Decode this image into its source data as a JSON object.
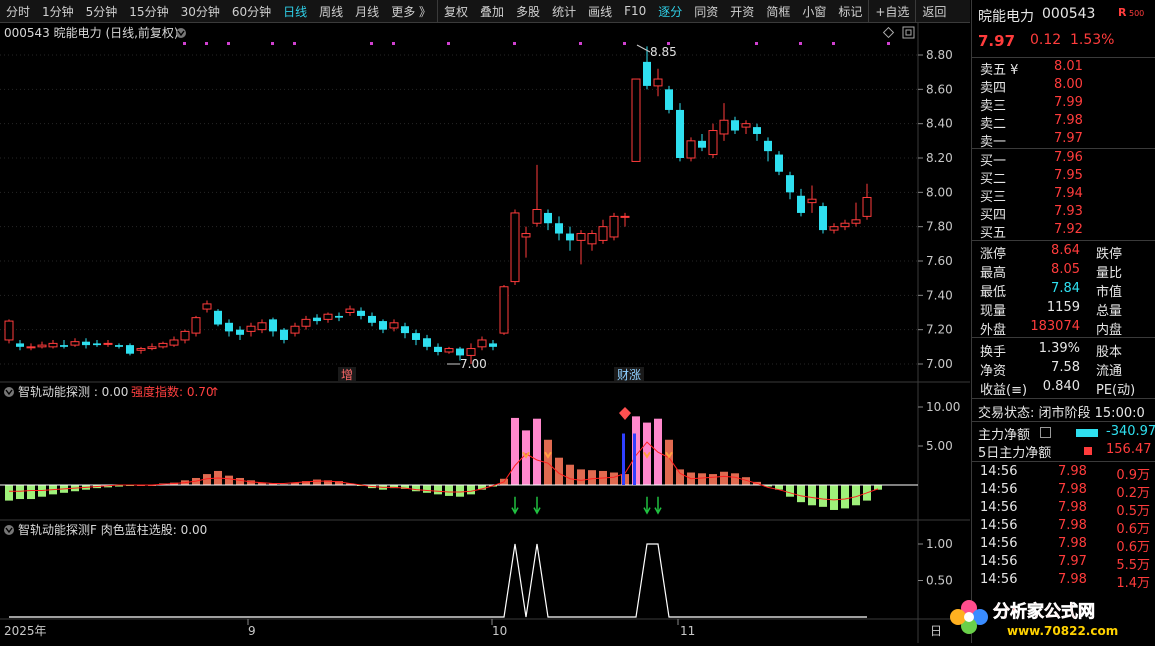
{
  "toolbar": {
    "items": [
      {
        "label": "分时"
      },
      {
        "label": "1分钟"
      },
      {
        "label": "5分钟"
      },
      {
        "label": "15分钟"
      },
      {
        "label": "30分钟"
      },
      {
        "label": "60分钟"
      },
      {
        "label": "日线",
        "active": true
      },
      {
        "label": "周线"
      },
      {
        "label": "月线"
      },
      {
        "label": "更多 》"
      },
      {
        "label": "复权"
      },
      {
        "label": "叠加"
      },
      {
        "label": "多股"
      },
      {
        "label": "统计"
      },
      {
        "label": "画线"
      },
      {
        "label": "F10"
      },
      {
        "label": "逐分",
        "active": true
      },
      {
        "label": "同资"
      },
      {
        "label": "开资"
      },
      {
        "label": "简框"
      },
      {
        "label": "小窗"
      },
      {
        "label": "标记"
      },
      {
        "label": "+自选"
      },
      {
        "label": "返回"
      }
    ]
  },
  "main_chart": {
    "title": "000543 晥能电力 (日线,前复权)",
    "high_marker": "8.85",
    "low_marker": "7.00",
    "tags": [
      "增",
      "财涨"
    ],
    "y_ticks": [
      "8.80",
      "8.60",
      "8.40",
      "8.20",
      "8.00",
      "7.80",
      "7.60",
      "7.40",
      "7.20",
      "7.00"
    ],
    "icons": [
      "collapse-icon",
      "diamond-icon",
      "window-icon"
    ]
  },
  "indicator1": {
    "title": "智轨动能探测 : 0.00",
    "extra": "强度指数: 0.70",
    "y_ticks": [
      "10.00",
      "5.00"
    ]
  },
  "indicator2": {
    "title": "智轨动能探测F  肉色蓝柱选股: 0.00",
    "y_ticks": [
      "1.00",
      "0.50"
    ]
  },
  "x_axis": {
    "labels": [
      "2025年",
      "9",
      "10",
      "11",
      "日"
    ]
  },
  "chart_data": {
    "type": "candlestick",
    "ylim": [
      6.95,
      8.9
    ],
    "candles": [
      [
        7.14,
        7.25,
        7.26,
        7.12
      ],
      [
        7.12,
        7.1,
        7.14,
        7.08
      ],
      [
        7.1,
        7.1,
        7.12,
        7.08
      ],
      [
        7.1,
        7.11,
        7.13,
        7.09
      ],
      [
        7.1,
        7.12,
        7.14,
        7.09
      ],
      [
        7.11,
        7.1,
        7.14,
        7.09
      ],
      [
        7.11,
        7.13,
        7.15,
        7.1
      ],
      [
        7.13,
        7.11,
        7.15,
        7.09
      ],
      [
        7.12,
        7.11,
        7.14,
        7.1
      ],
      [
        7.12,
        7.12,
        7.14,
        7.1
      ],
      [
        7.11,
        7.1,
        7.12,
        7.09
      ],
      [
        7.11,
        7.06,
        7.12,
        7.05
      ],
      [
        7.08,
        7.09,
        7.1,
        7.06
      ],
      [
        7.09,
        7.1,
        7.12,
        7.08
      ],
      [
        7.1,
        7.12,
        7.13,
        7.09
      ],
      [
        7.11,
        7.14,
        7.16,
        7.1
      ],
      [
        7.14,
        7.19,
        7.2,
        7.12
      ],
      [
        7.18,
        7.27,
        7.28,
        7.16
      ],
      [
        7.32,
        7.35,
        7.37,
        7.3
      ],
      [
        7.31,
        7.23,
        7.32,
        7.22
      ],
      [
        7.24,
        7.19,
        7.26,
        7.16
      ],
      [
        7.2,
        7.17,
        7.22,
        7.14
      ],
      [
        7.19,
        7.22,
        7.24,
        7.16
      ],
      [
        7.2,
        7.24,
        7.26,
        7.18
      ],
      [
        7.26,
        7.19,
        7.27,
        7.16
      ],
      [
        7.2,
        7.14,
        7.21,
        7.12
      ],
      [
        7.18,
        7.22,
        7.24,
        7.16
      ],
      [
        7.22,
        7.26,
        7.28,
        7.2
      ],
      [
        7.27,
        7.25,
        7.29,
        7.23
      ],
      [
        7.26,
        7.29,
        7.3,
        7.24
      ],
      [
        7.28,
        7.27,
        7.3,
        7.25
      ],
      [
        7.3,
        7.32,
        7.34,
        7.28
      ],
      [
        7.31,
        7.28,
        7.33,
        7.26
      ],
      [
        7.28,
        7.24,
        7.3,
        7.22
      ],
      [
        7.25,
        7.2,
        7.26,
        7.18
      ],
      [
        7.21,
        7.24,
        7.26,
        7.19
      ],
      [
        7.22,
        7.18,
        7.24,
        7.15
      ],
      [
        7.18,
        7.14,
        7.2,
        7.11
      ],
      [
        7.15,
        7.1,
        7.17,
        7.08
      ],
      [
        7.1,
        7.07,
        7.12,
        7.05
      ],
      [
        7.07,
        7.09,
        7.1,
        7.06
      ],
      [
        7.09,
        7.05,
        7.1,
        7.02
      ],
      [
        7.05,
        7.09,
        7.12,
        7.0
      ],
      [
        7.1,
        7.14,
        7.16,
        7.08
      ],
      [
        7.12,
        7.1,
        7.14,
        7.08
      ],
      [
        7.18,
        7.45,
        7.46,
        7.17
      ],
      [
        7.48,
        7.88,
        7.9,
        7.46
      ],
      [
        7.74,
        7.76,
        7.8,
        7.62
      ],
      [
        7.82,
        7.9,
        8.16,
        7.8
      ],
      [
        7.88,
        7.82,
        7.9,
        7.78
      ],
      [
        7.82,
        7.76,
        7.86,
        7.72
      ],
      [
        7.76,
        7.72,
        7.8,
        7.66
      ],
      [
        7.72,
        7.76,
        7.78,
        7.58
      ],
      [
        7.7,
        7.76,
        7.78,
        7.66
      ],
      [
        7.72,
        7.8,
        7.84,
        7.7
      ],
      [
        7.74,
        7.86,
        7.88,
        7.72
      ],
      [
        7.86,
        7.86,
        7.88,
        7.8
      ],
      [
        8.18,
        8.66,
        8.66,
        8.18
      ],
      [
        8.76,
        8.62,
        8.85,
        8.6
      ],
      [
        8.62,
        8.66,
        8.72,
        8.56
      ],
      [
        8.6,
        8.48,
        8.62,
        8.46
      ],
      [
        8.48,
        8.2,
        8.52,
        8.18
      ],
      [
        8.2,
        8.3,
        8.32,
        8.18
      ],
      [
        8.3,
        8.26,
        8.34,
        8.24
      ],
      [
        8.22,
        8.36,
        8.4,
        8.2
      ],
      [
        8.34,
        8.42,
        8.52,
        8.3
      ],
      [
        8.42,
        8.36,
        8.44,
        8.34
      ],
      [
        8.38,
        8.4,
        8.42,
        8.34
      ],
      [
        8.38,
        8.34,
        8.4,
        8.3
      ],
      [
        8.3,
        8.24,
        8.32,
        8.18
      ],
      [
        8.22,
        8.12,
        8.24,
        8.1
      ],
      [
        8.1,
        8.0,
        8.12,
        7.96
      ],
      [
        7.98,
        7.88,
        8.02,
        7.86
      ],
      [
        7.94,
        7.96,
        8.04,
        7.88
      ],
      [
        7.92,
        7.78,
        7.94,
        7.76
      ],
      [
        7.78,
        7.8,
        7.82,
        7.76
      ],
      [
        7.8,
        7.82,
        7.84,
        7.78
      ],
      [
        7.82,
        7.84,
        7.94,
        7.8
      ],
      [
        7.86,
        7.97,
        8.05,
        7.84
      ]
    ],
    "ind1_bars": [
      -2.0,
      -1.8,
      -1.8,
      -1.5,
      -1.2,
      -1.0,
      -0.8,
      -0.6,
      -0.4,
      -0.3,
      -0.2,
      -0.1,
      0.0,
      0.0,
      0.2,
      0.3,
      0.6,
      0.9,
      1.4,
      1.8,
      1.2,
      0.9,
      0.6,
      0.3,
      0.2,
      0.1,
      0.3,
      0.5,
      0.7,
      0.6,
      0.5,
      0.2,
      -0.1,
      -0.4,
      -0.6,
      -0.4,
      -0.5,
      -0.8,
      -1.0,
      -1.2,
      -1.4,
      -1.5,
      -1.2,
      -0.6,
      -0.2,
      0.8,
      8.6,
      7.0,
      8.5,
      5.8,
      3.5,
      2.6,
      2.0,
      1.9,
      1.8,
      1.6,
      1.4,
      8.8,
      8.0,
      8.5,
      5.8,
      2.0,
      1.6,
      1.5,
      1.4,
      1.7,
      1.5,
      1.0,
      0.4,
      -0.2,
      -0.6,
      -1.5,
      -2.2,
      -2.6,
      -2.8,
      -3.2,
      -3.0,
      -2.6,
      -2.0,
      -0.6
    ],
    "ind1_pink": [
      46,
      47,
      48,
      57,
      58,
      59
    ],
    "ind1_line": [
      -0.8,
      -0.8,
      -0.7,
      -0.7,
      -0.6,
      -0.5,
      -0.4,
      -0.3,
      -0.2,
      -0.1,
      0.0,
      0.0,
      0.0,
      0.0,
      0.1,
      0.2,
      0.3,
      0.5,
      0.8,
      0.9,
      0.8,
      0.6,
      0.4,
      0.3,
      0.2,
      0.2,
      0.3,
      0.4,
      0.5,
      0.5,
      0.4,
      0.2,
      0.0,
      -0.2,
      -0.3,
      -0.3,
      -0.4,
      -0.6,
      -0.7,
      -0.8,
      -0.9,
      -0.9,
      -0.8,
      -0.5,
      -0.1,
      0.4,
      2.5,
      4.0,
      3.2,
      2.8,
      1.5,
      0.8,
      0.6,
      0.8,
      0.9,
      1.0,
      1.5,
      3.8,
      5.5,
      4.2,
      3.5,
      1.5,
      0.8,
      0.9,
      1.0,
      1.1,
      1.0,
      0.6,
      0.2,
      -0.3,
      -0.6,
      -1.0,
      -1.4,
      -1.6,
      -1.8,
      -1.9,
      -1.8,
      -1.5,
      -1.0,
      -0.5
    ],
    "ind2_x": [
      0,
      43,
      44,
      45,
      46,
      47,
      48,
      49,
      50,
      55,
      56,
      57,
      58,
      59,
      60,
      61,
      62,
      63,
      78
    ],
    "ind2_y": [
      0,
      0,
      0,
      0,
      1,
      0,
      1,
      0,
      0,
      0,
      0,
      0,
      1,
      1,
      0,
      0,
      0,
      0,
      0
    ]
  },
  "side": {
    "name": "晥能电力",
    "code": "000543",
    "badge": "R",
    "badge_small": "500",
    "price": "7.97",
    "change": "0.12",
    "pct": "1.53%",
    "asks": [
      {
        "label": "卖五 ¥",
        "price": "8.01"
      },
      {
        "label": "卖四",
        "price": "8.00"
      },
      {
        "label": "卖三",
        "price": "7.99"
      },
      {
        "label": "卖二",
        "price": "7.98"
      },
      {
        "label": "卖一",
        "price": "7.97"
      }
    ],
    "bids": [
      {
        "label": "买一",
        "price": "7.96"
      },
      {
        "label": "买二",
        "price": "7.95"
      },
      {
        "label": "买三",
        "price": "7.94"
      },
      {
        "label": "买四",
        "price": "7.93"
      },
      {
        "label": "买五",
        "price": "7.92"
      }
    ],
    "stats1": [
      {
        "l": "涨停",
        "v": "8.64",
        "c": "red",
        "r": "跌停"
      },
      {
        "l": "最高",
        "v": "8.05",
        "c": "red",
        "r": "量比"
      },
      {
        "l": "最低",
        "v": "7.84",
        "c": "green",
        "r": "市值"
      },
      {
        "l": "现量",
        "v": "1159",
        "c": "white",
        "r": "总量"
      },
      {
        "l": "外盘",
        "v": "183074",
        "c": "red",
        "r": "内盘"
      }
    ],
    "stats2": [
      {
        "l": "换手",
        "v": "1.39%",
        "c": "white",
        "r": "股本"
      },
      {
        "l": "净资",
        "v": "7.58",
        "c": "white",
        "r": "流通"
      },
      {
        "l": "收益(≡)",
        "v": "0.840",
        "c": "white",
        "r": "PE(动)"
      }
    ],
    "trade_state": "交易状态: 闭市阶段 15:00:0",
    "main_flow_label": "主力净额",
    "main_flow_value": "-340.97",
    "flow5_label": "5日主力净额",
    "flow5_value": "156.47",
    "ticks": [
      {
        "t": "14:56",
        "p": "7.98",
        "v": "0.9万"
      },
      {
        "t": "14:56",
        "p": "7.98",
        "v": "0.2万"
      },
      {
        "t": "14:56",
        "p": "7.98",
        "v": "0.5万"
      },
      {
        "t": "14:56",
        "p": "7.98",
        "v": "0.6万"
      },
      {
        "t": "14:56",
        "p": "7.98",
        "v": "0.6万"
      },
      {
        "t": "14:56",
        "p": "7.97",
        "v": "5.5万"
      },
      {
        "t": "14:56",
        "p": "7.98",
        "v": "1.4万"
      }
    ],
    "logo_text": "分析家公式网",
    "logo_url": "www.70822.com"
  },
  "colors": {
    "up": "#ff3c3c",
    "down": "#2fe0f0",
    "bg": "#000000",
    "grid": "#333333",
    "pink": "#ff88cc",
    "salmon": "#e06a50",
    "lightgreen": "#9ff07a"
  }
}
